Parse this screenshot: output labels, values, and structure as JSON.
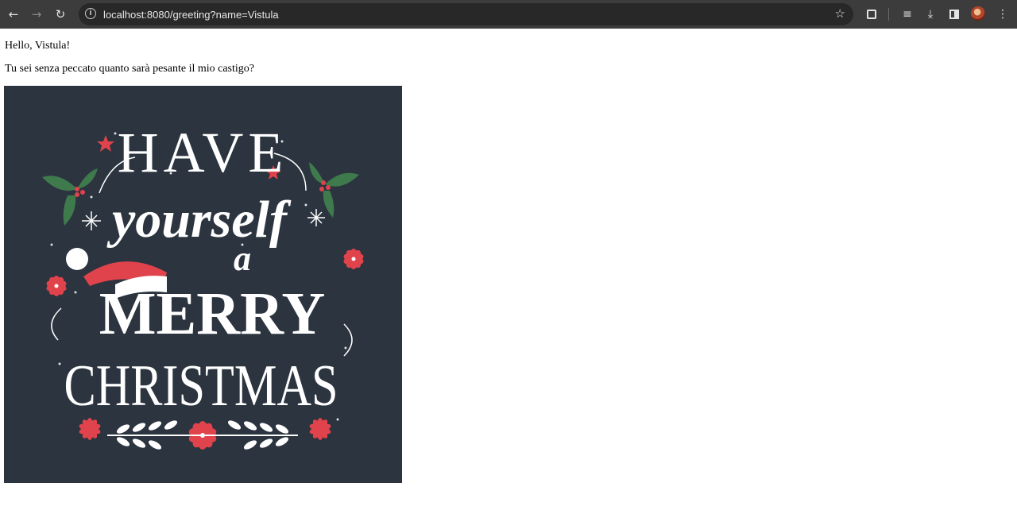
{
  "browser": {
    "url": "localhost:8080/greeting?name=Vistula",
    "icons": [
      "back-icon",
      "forward-icon",
      "reload-icon",
      "site-info-icon",
      "star-icon",
      "extensions-icon",
      "media-icon",
      "download-icon",
      "side-panel-icon",
      "avatar",
      "menu-icon"
    ]
  },
  "page": {
    "greeting": "Hello, Vistula!",
    "quote": "Tu sei senza peccato quanto sarà pesante il mio castigo?"
  },
  "image": {
    "lines": [
      "HAVE",
      "yourself",
      "a",
      "MERRY",
      "CHRISTMAS"
    ],
    "colors": {
      "background": "#2b343f",
      "text": "#ffffff",
      "accent": "#e0434b",
      "leaf": "#3f7a4d"
    }
  }
}
